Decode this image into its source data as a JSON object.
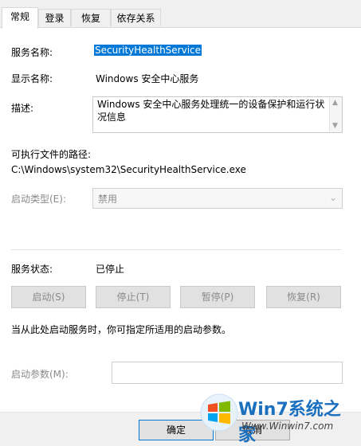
{
  "tabs": [
    "常规",
    "登录",
    "恢复",
    "依存关系"
  ],
  "general": {
    "service_name_label": "服务名称:",
    "service_name_value": "SecurityHealthService",
    "display_name_label": "显示名称:",
    "display_name_value": "Windows 安全中心服务",
    "description_label": "描述:",
    "description_value": "Windows 安全中心服务处理统一的设备保护和运行状况信息",
    "exe_path_label": "可执行文件的路径:",
    "exe_path_value": "C:\\Windows\\system32\\SecurityHealthService.exe",
    "startup_type_label": "启动类型(E):",
    "startup_type_value": "禁用",
    "service_status_label": "服务状态:",
    "service_status_value": "已停止",
    "buttons": {
      "start": "启动(S)",
      "stop": "停止(T)",
      "pause": "暂停(P)",
      "resume": "恢复(R)"
    },
    "start_params_hint": "当从此处启动服务时，你可指定所适用的启动参数。",
    "start_params_label": "启动参数(M):",
    "start_params_value": ""
  },
  "dialog_buttons": {
    "ok": "确定",
    "cancel": "取消"
  },
  "watermark": {
    "title": "Win7系统之家",
    "url": "Www.Winwin7.com"
  }
}
